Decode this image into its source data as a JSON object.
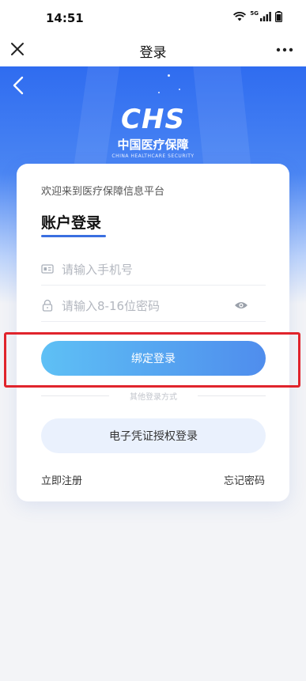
{
  "status_bar": {
    "time": "14:51",
    "network": "5G"
  },
  "nav": {
    "title": "登录"
  },
  "logo": {
    "mark": "CHS",
    "name_cn": "中国医疗保障",
    "name_en": "CHINA HEALTHCARE SECURITY"
  },
  "card": {
    "welcome": "欢迎来到医疗保障信息平台",
    "title": "账户登录",
    "phone": {
      "placeholder": "请输入手机号",
      "value": ""
    },
    "password": {
      "placeholder": "请输入8-16位密码",
      "value": ""
    },
    "bind_login_label": "绑定登录",
    "other_methods": "其他登录方式",
    "cert_login_label": "电子凭证授权登录",
    "register_label": "立即注册",
    "forgot_label": "忘记密码"
  },
  "colors": {
    "accent": "#4f8ded",
    "hero_top": "#2f6cf0",
    "highlight": "#e0242c",
    "secondary_bg": "#eaf1fd"
  },
  "icons": [
    "close-icon",
    "more-icon",
    "back-icon",
    "id-card-icon",
    "lock-icon",
    "eye-icon",
    "wifi-icon",
    "signal-icon",
    "battery-icon"
  ]
}
